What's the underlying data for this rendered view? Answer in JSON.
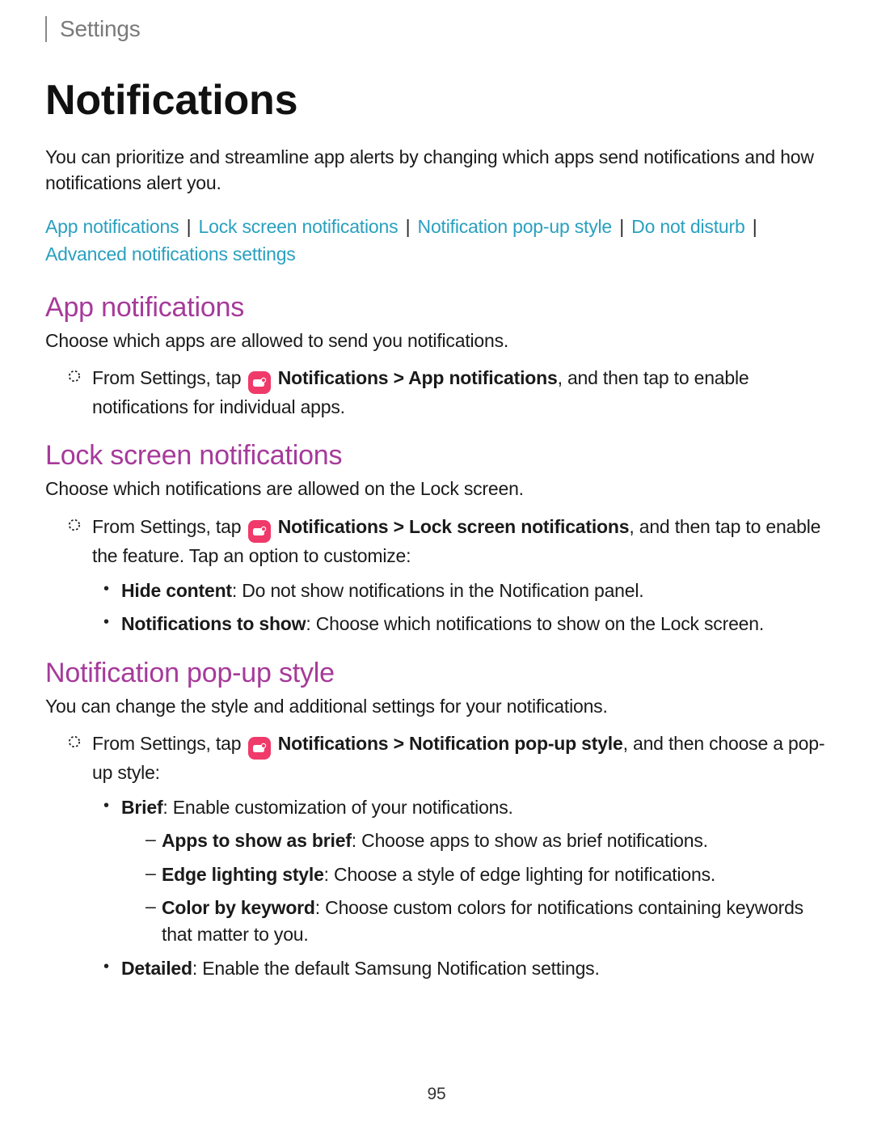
{
  "breadcrumb": "Settings",
  "title": "Notifications",
  "intro": "You can prioritize and streamline app alerts by changing which apps send notifications and how notifications alert you.",
  "links": {
    "app": "App notifications",
    "lock": "Lock screen notifications",
    "popup": "Notification pop-up style",
    "dnd": "Do not disturb",
    "adv": "Advanced notifications settings"
  },
  "app_section": {
    "heading": "App notifications",
    "lead": "Choose which apps are allowed to send you notifications.",
    "step_pre": "From Settings, tap ",
    "step_bold": "Notifications > App notifications",
    "step_post": ", and then tap to enable notifications for individual apps."
  },
  "lock_section": {
    "heading": "Lock screen notifications",
    "lead": "Choose which notifications are allowed on the Lock screen.",
    "step_pre": "From Settings, tap ",
    "step_bold": "Notifications > Lock screen notifications",
    "step_post": ", and then tap to enable the feature. Tap an option to customize:",
    "hide_label": "Hide content",
    "hide_text": ": Do not show notifications in the Notification panel.",
    "show_label": "Notifications to show",
    "show_text": ": Choose which notifications to show on the Lock screen."
  },
  "popup_section": {
    "heading": "Notification pop-up style",
    "lead": "You can change the style and additional settings for your notifications.",
    "step_pre": "From Settings, tap ",
    "step_bold": "Notifications > Notification pop-up style",
    "step_post": ", and then choose a pop-up style:",
    "brief_label": "Brief",
    "brief_text": ": Enable customization of your notifications.",
    "apps_label": "Apps to show as brief",
    "apps_text": ": Choose apps to show as brief notifications.",
    "edge_label": "Edge lighting style",
    "edge_text": ": Choose a style of edge lighting for notifications.",
    "color_label": "Color by keyword",
    "color_text": ": Choose custom colors for notifications containing keywords that matter to you.",
    "detailed_label": "Detailed",
    "detailed_text": ": Enable the default Samsung Notification settings."
  },
  "page_number": "95"
}
